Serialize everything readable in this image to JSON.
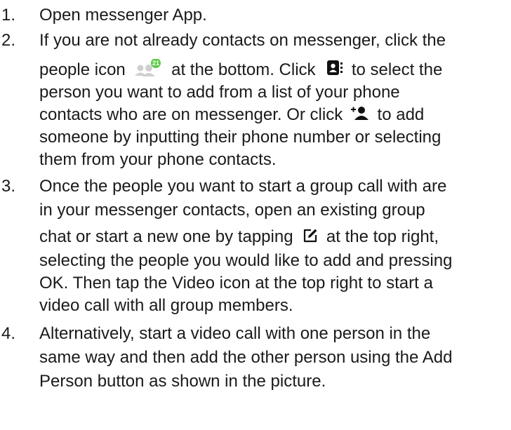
{
  "steps": [
    {
      "number": "1.",
      "lines": [
        "Open messenger App."
      ]
    },
    {
      "number": "2.",
      "lines": [
        "If you are not already contacts on messenger, click the",
        "people icon",
        "at the bottom. Click",
        "to select the",
        "person you want to add from a list of your phone",
        "contacts who are on messenger. Or click",
        "to add",
        "someone by inputting their phone number or selecting",
        "them from your phone contacts."
      ]
    },
    {
      "number": "3.",
      "lines": [
        "Once the people you want to start a group call with are",
        "in your messenger contacts, open an existing group",
        "chat or start a new one by tapping",
        "at the top right,",
        "selecting the people you would like to add and pressing",
        "OK. Then tap the Video icon at the top right to start a",
        "video call with all group members."
      ]
    },
    {
      "number": "4.",
      "lines": [
        "Alternatively, start a video call with one person in the",
        "same way and then add the other person using the Add",
        "Person button as shown in the picture."
      ]
    }
  ],
  "icons": {
    "people_badge": "21",
    "people_icon": "people-icon",
    "contacts_book_icon": "contacts-book-icon",
    "add_person_icon": "add-person-icon",
    "compose_icon": "compose-icon",
    "badge_color": "#5dc94a",
    "icon_grey": "#cfcfcf"
  }
}
